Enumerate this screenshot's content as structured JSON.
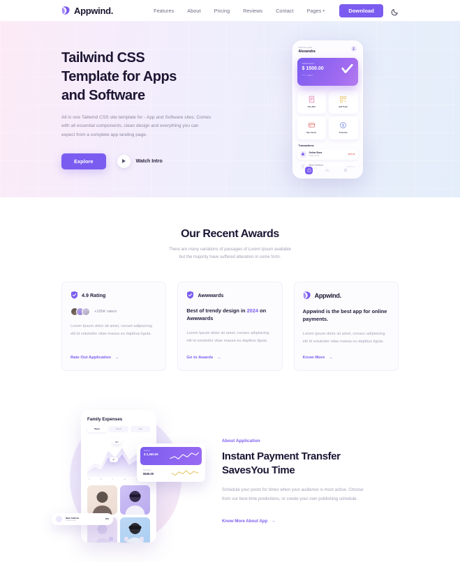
{
  "header": {
    "logo_text": "Appwind.",
    "nav": [
      {
        "label": "Features",
        "has_caret": false
      },
      {
        "label": "About",
        "has_caret": false
      },
      {
        "label": "Pricing",
        "has_caret": false
      },
      {
        "label": "Reviews",
        "has_caret": false
      },
      {
        "label": "Contact",
        "has_caret": false
      },
      {
        "label": "Pages",
        "has_caret": true
      }
    ],
    "caret": "▾",
    "download_label": "Download",
    "theme_toggle": "moon-icon"
  },
  "hero": {
    "title_line1": "Tailwind CSS",
    "title_line2": "Template for Apps",
    "title_line3": "and Software",
    "subtitle": "All in one Tailwind CSS site template for - App and Software sites. Comes with all essential components, clean design and everything you can expect from a complete app landing page.",
    "primary_button": "Explore",
    "secondary_button": "Watch Intro",
    "phone": {
      "greeting": "Welcome back",
      "name": "Alexandra",
      "balance_label": "Total Amount",
      "balance_amount": "$ 1500.00",
      "card_number": "**** 4291",
      "tiles": [
        {
          "label": "Pay Bill",
          "icon": "bill-icon"
        },
        {
          "label": "QR Scan",
          "icon": "qr-icon"
        },
        {
          "label": "My Cards",
          "icon": "card-icon"
        },
        {
          "label": "Transfer",
          "icon": "transfer-icon"
        }
      ],
      "transactions_title": "Transactions",
      "transactions": [
        {
          "name": "Online Store",
          "date": "Today, 10:24",
          "amount": "-$37.20",
          "faded": false
        },
        {
          "name": "Mark Sullivan",
          "date": "Today, 09:02",
          "amount": "-$120.00",
          "faded": true
        }
      ]
    }
  },
  "awards": {
    "title": "Our Recent Awards",
    "subtitle_line1": "There are many variations of passages of Lorem Ipsum available",
    "subtitle_line2": "but the majority have suffered alteration in some form.",
    "cards": [
      {
        "icon": "shield-icon",
        "head_label": "4.9 Rating",
        "raters": "+195K raters",
        "body": "Lorem Ipsum dolor sit amet, conset adipisicing elit id volutodor vitae massa eu dapibus ligula.",
        "link": "Rate Out Application",
        "arrow": "→"
      },
      {
        "icon": "shield-icon",
        "head_label": "Awwwards",
        "headline_pre": "Best of trendy design in ",
        "headline_em": "2024",
        "headline_post": " on Awwwards",
        "body": "Lorem Ipsum dolor sit amet, consec adipisicing elit id volutodor vitae massa eu dapibus ligula.",
        "link": "Go to Awards",
        "arrow": "→"
      },
      {
        "icon": "appwind-logo-icon",
        "head_label": "Appwind.",
        "headline": "Appwind is the best app for online payments.",
        "body": "Lorem ipsum dolor sit amet, consec adipisicing elit id volutodor vitae massa eu dapibus ligula.",
        "link": "Know More",
        "arrow": "→"
      }
    ]
  },
  "about": {
    "eyebrow": "About Application",
    "title_line1": "Instant Payment Transfer",
    "title_line2": "SavesYou Time",
    "body": "Schedule your posts for times when your audience is most active. Choose from our best-time predictions, or create your own publishing schedule.",
    "link": "Know More About App",
    "arrow": "→",
    "phone": {
      "title": "Family Expenses",
      "tabs": [
        "Week",
        "Month",
        "Year"
      ],
      "chart_bubble_top": "$84",
      "chart_bubble_mid": "$7",
      "axis": [
        "S",
        "M",
        "T",
        "W",
        "T",
        "F"
      ]
    },
    "float_card": {
      "top_label": "Income",
      "top_amount": "$ 2,450.00",
      "bottom_label": "Spending",
      "bottom_amount": "$645.00"
    },
    "pill_card": {
      "title": "Mark Sullivan",
      "subtitle": "Transfer sent",
      "amount": "$72"
    }
  },
  "colors": {
    "accent": "#7b5cf0",
    "heading": "#1b1533",
    "muted": "#a5a0b6"
  }
}
